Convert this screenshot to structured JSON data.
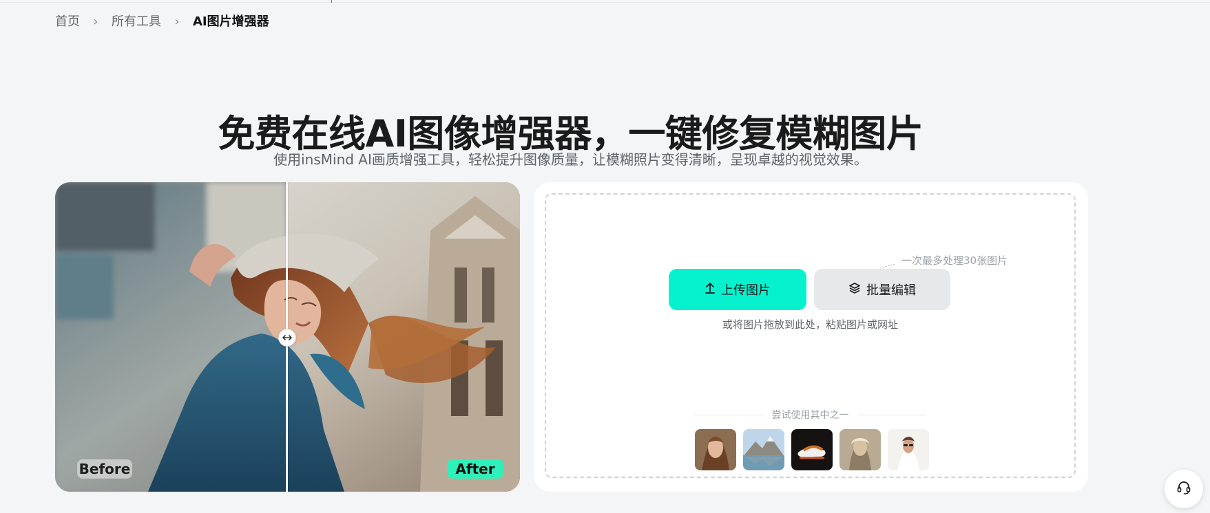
{
  "breadcrumb": {
    "items": [
      "首页",
      "所有工具"
    ],
    "current": "AI图片增强器"
  },
  "hero": {
    "title": "免费在线AI图像增强器，一键修复模糊图片",
    "subtitle": "使用insMind AI画质增强工具，轻松提升图像质量，让模糊照片变得清晰，呈现卓越的视觉效果。"
  },
  "comparison": {
    "before_label": "Before",
    "after_label": "After",
    "split_fraction": 0.5
  },
  "upload": {
    "batch_note": "一次最多处理30张图片",
    "upload_button": "上传图片",
    "batch_button": "批量编辑",
    "drop_hint": "或将图片拖放到此处，粘贴图片或网址",
    "samples_label": "尝试使用其中之一",
    "sample_images": [
      "portrait-woman",
      "mountain-lake",
      "sneaker",
      "vintage-portrait",
      "woman-sunglasses"
    ]
  },
  "colors": {
    "accent": "#06f2cf",
    "secondary_button": "#e7e8ea",
    "page_background": "#f3f5f7"
  },
  "icons": {
    "upload": "upload-icon",
    "batch": "layers-icon",
    "divider": "double-arrow-icon",
    "support": "headset-icon"
  }
}
